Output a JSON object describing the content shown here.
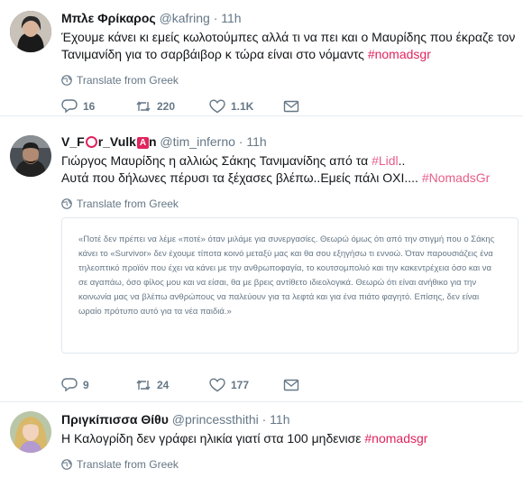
{
  "tweets": [
    {
      "name": "Μπλε Φρίκαρος",
      "handle": "@kafring",
      "time": "11h",
      "text": "Έχουμε κάνει κι εμείς κωλοτούμπες αλλά τι να πει και ο Μαυρίδης που έκραζε τον Τανιμανίδη για το σαρβάιβορ κ τώρα είναι στο νόμαντς ",
      "hashtag": "#nomadsgr",
      "translate": "Translate from Greek",
      "replies": "16",
      "retweets": "220",
      "likes": "1.1K"
    },
    {
      "name_part1": "V_F",
      "name_part2": "r_Vulk",
      "name_part3": "n",
      "badge_letter": "A",
      "handle": "@tim_inferno",
      "time": "11h",
      "line1": "Γιώργος Μαυρίδης η αλλιώς Σάκης Τανιμανίδης από τα ",
      "line1_tag": "#Lidl",
      "line1_end": "..",
      "line2": "Αυτά που δήλωνες πέρυσι τα ξέχασες βλέπω..Εμείς πάλι ΟΧΙ.... ",
      "line2_tag": "#NomadsGr",
      "translate": "Translate from Greek",
      "quote": "«Ποτέ δεν πρέπει να λέμε «ποτέ» όταν μιλάμε για συνεργασίες. Θεωρώ όμως ότι από την στιγμή που ο Σάκης κάνει το «Survivor» δεν έχουμε τίποτα κοινό μεταξύ μας και θα σου εξηγήσω τι εννοώ. Όταν παρουσιάζεις ένα τηλεοπτικό προϊόν που έχει να κάνει με την ανθρωποφαγία, το κουτσομπολιό και την κακεντρέχεια όσο και να σε αγαπάω, όσο φίλος μου και να είσαι, θα με βρεις αντίθετο ιδιεολογικά. Θεωρώ ότι είναι ανήθικο για την κοινωνία μας να βλέπω ανθρώπους να παλεύουν για τα λεφτά και για ένα πιάτο φαγητό. Επίσης, δεν είναι ωραίο πρότυπο αυτό για τα νέα παιδιά.»",
      "replies": "9",
      "retweets": "24",
      "likes": "177"
    },
    {
      "name": "Πριγκίπισσα Θίθυ",
      "handle": "@princessthithi",
      "time": "11h",
      "text": "Η Καλογρίδη δεν γράφει ηλικία γιατί στα 100 μηδενισε ",
      "hashtag": "#nomadsgr",
      "translate": "Translate from Greek"
    }
  ],
  "dot": "·",
  "icons": [
    "reply-icon",
    "retweet-icon",
    "like-icon",
    "dm-icon",
    "globe-icon"
  ],
  "colors": {
    "hashtag": "#e0245e",
    "muted": "#657786",
    "border": "#e6ecf0"
  }
}
